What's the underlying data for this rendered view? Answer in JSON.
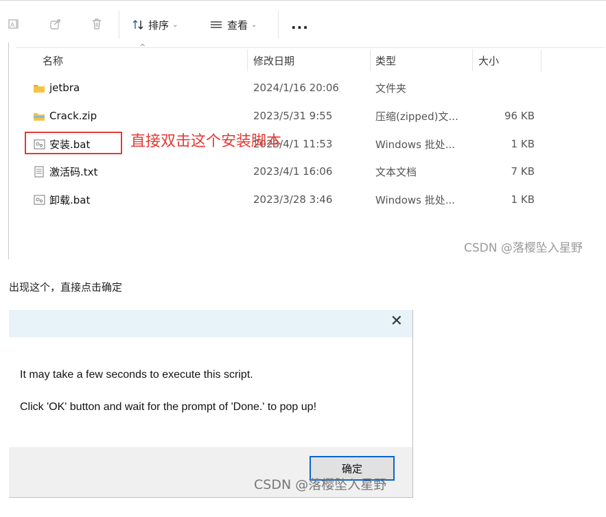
{
  "toolbar": {
    "sort_label": "排序",
    "view_label": "查看",
    "more_label": "···"
  },
  "columns": {
    "name": "名称",
    "modified": "修改日期",
    "type": "类型",
    "size": "大小"
  },
  "files": [
    {
      "name": "jetbra",
      "modified": "2024/1/16 20:06",
      "type": "文件夹",
      "size": "",
      "icon": "folder-icon"
    },
    {
      "name": "Crack.zip",
      "modified": "2023/5/31 9:55",
      "type": "压缩(zipped)文...",
      "size": "96 KB",
      "icon": "zip-folder-icon"
    },
    {
      "name": "安装.bat",
      "modified": "2023/4/1 11:53",
      "type": "Windows 批处...",
      "size": "1 KB",
      "icon": "batch-file-icon"
    },
    {
      "name": "激活码.txt",
      "modified": "2023/4/1 16:06",
      "type": "文本文档",
      "size": "7 KB",
      "icon": "text-file-icon"
    },
    {
      "name": "卸载.bat",
      "modified": "2023/3/28 3:46",
      "type": "Windows 批处...",
      "size": "1 KB",
      "icon": "batch-file-icon"
    }
  ],
  "annotation": "直接双击这个安装脚本",
  "watermark": "CSDN @落樱坠入星野",
  "caption": "出现这个，直接点击确定",
  "dialog": {
    "close": "✕",
    "line1": "It may take a few seconds to execute this script.",
    "line2": "Click 'OK' button and wait for the prompt of 'Done.' to pop up!",
    "ok_label": "确定"
  },
  "colors": {
    "annotation_red": "#e53935",
    "dialog_titlebar": "#e7f3f8",
    "folder_yellow": "#f5c542",
    "focus_blue": "#0a64c8"
  }
}
